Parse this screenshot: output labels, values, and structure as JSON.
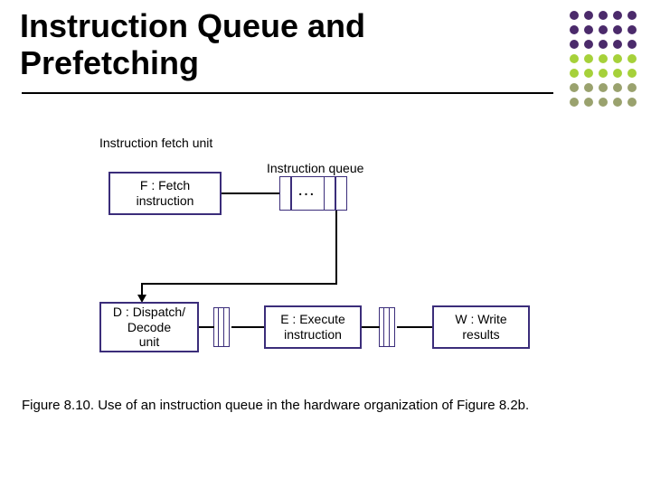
{
  "title_line1": "Instruction Queue and",
  "title_line2": "Prefetching",
  "labels": {
    "fetch_unit": "Instruction fetch unit",
    "queue": "Instruction queue"
  },
  "boxes": {
    "fetch": "F : Fetch\ninstruction",
    "dispatch": "D : Dispatch/\nDecode\nunit",
    "execute": "E : Execute\ninstruction",
    "write": "W : Write\nresults"
  },
  "queue_ellipsis": "…",
  "caption": "Figure 8.10.  Use of an instruction queue in the hardware organization of Figure 8.2b."
}
